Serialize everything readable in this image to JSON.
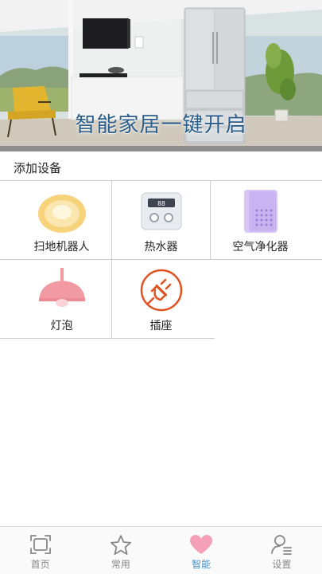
{
  "banner": {
    "title": "智能家居一键开启"
  },
  "section": {
    "title": "添加设备"
  },
  "devices": [
    {
      "label": "扫地机器人",
      "icon": "robot-vacuum-icon"
    },
    {
      "label": "热水器",
      "icon": "water-heater-icon"
    },
    {
      "label": "空气净化器",
      "icon": "air-purifier-icon"
    },
    {
      "label": "灯泡",
      "icon": "pendant-lamp-icon"
    },
    {
      "label": "插座",
      "icon": "plug-icon"
    }
  ],
  "tabbar": {
    "items": [
      {
        "label": "首页",
        "icon": "home-frame-icon",
        "active": false
      },
      {
        "label": "常用",
        "icon": "star-icon",
        "active": false
      },
      {
        "label": "智能",
        "icon": "heart-icon",
        "active": true
      },
      {
        "label": "设置",
        "icon": "user-settings-icon",
        "active": false
      }
    ]
  },
  "colors": {
    "accent": "#4a90c8",
    "banner_title": "#2a5d8a",
    "grid_line": "#cfcfcf",
    "plug": "#e0521f",
    "lamp": "#f19aa3",
    "purifier": "#c9b3f0",
    "heart": "#f4a0b8"
  }
}
